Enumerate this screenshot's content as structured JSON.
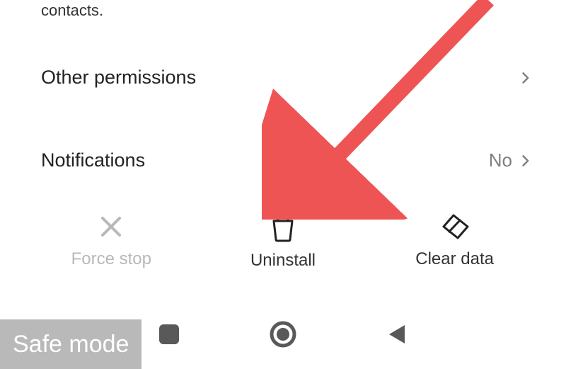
{
  "header_fragment": "contacts.",
  "rows": {
    "permissions": {
      "title": "Other permissions"
    },
    "notifications": {
      "title": "Notifications",
      "value": "No"
    }
  },
  "actions": {
    "force_stop": {
      "label": "Force stop"
    },
    "uninstall": {
      "label": "Uninstall"
    },
    "clear_data": {
      "label": "Clear data"
    }
  },
  "safe_mode_label": "Safe mode",
  "colors": {
    "arrow": "#ee5454",
    "chevron": "#808080",
    "disabled": "#b8b8b8",
    "icon": "#222222",
    "nav": "#595959"
  }
}
